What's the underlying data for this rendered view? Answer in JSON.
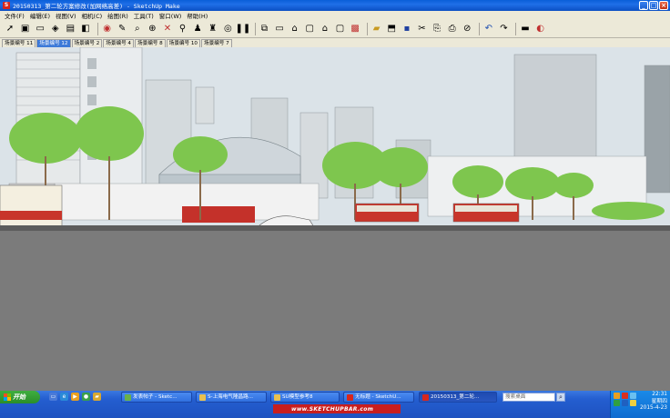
{
  "window": {
    "title": "20150313_第二轮方案修改(加网络高差) - SketchUp Make",
    "buttons": {
      "minimize": "_",
      "maximize": "□",
      "close": "×"
    }
  },
  "menu": [
    "文件(F)",
    "编辑(E)",
    "视图(V)",
    "相机(C)",
    "绘图(R)",
    "工具(T)",
    "窗口(W)",
    "帮助(H)"
  ],
  "toolbar": {
    "icons": [
      "select-icon",
      "make-component-icon",
      "eraser-icon",
      "paint-bucket-icon",
      "line-icon",
      "arc-icon",
      "shape-icon",
      "push-pull-icon",
      "move-icon",
      "rotate-icon",
      "offset-icon",
      "tape-measure-icon",
      "text-icon",
      "orbit-icon",
      "pan-icon",
      "zoom-icon",
      "zoom-extents-icon",
      "position-camera-icon",
      "walk-icon",
      "look-around-icon",
      "section-icon",
      "footprints-icon",
      "iso-view-icon",
      "top-view-icon",
      "front-view-icon",
      "right-view-icon",
      "back-view-icon",
      "left-view-icon",
      "get-models-icon",
      "share-model-icon",
      "components-icon",
      "save-icon",
      "paste-icon",
      "cut-icon",
      "erase-icon",
      "delete-icon",
      "undo-icon",
      "redo-icon",
      "print-icon",
      "model-info-icon"
    ]
  },
  "tabs": [
    "场景编号 11",
    "场景编号 12",
    "场景编号 2",
    "场景编号 4",
    "场景编号 8",
    "场景编号 10",
    "场景编号 7"
  ],
  "active_tab": 1,
  "viewport": {
    "scene": "3d-street-view",
    "colors": {
      "sky": "#d9e1e7",
      "ground": "#6b6b6b",
      "road": "#7f7f7f",
      "tree": "#76c24a",
      "bus": "#c8352a"
    }
  },
  "taskbar": {
    "start_label": "开始",
    "tasks": [
      {
        "label": "发表帖子 - Sketc...",
        "active": false
      },
      {
        "label": "S-上海电气隆昌路...",
        "active": false
      },
      {
        "label": "SU模型参考8",
        "active": false
      },
      {
        "label": "无标题 - SketchU...",
        "active": false
      },
      {
        "label": "20150313_第二轮...",
        "active": true
      }
    ],
    "search_placeholder": "搜索桌面",
    "clock": {
      "time": "22:31",
      "weekday": "星期四",
      "date": "2015-4-23"
    }
  },
  "watermark": "www.SKETCHUPBAR.com"
}
